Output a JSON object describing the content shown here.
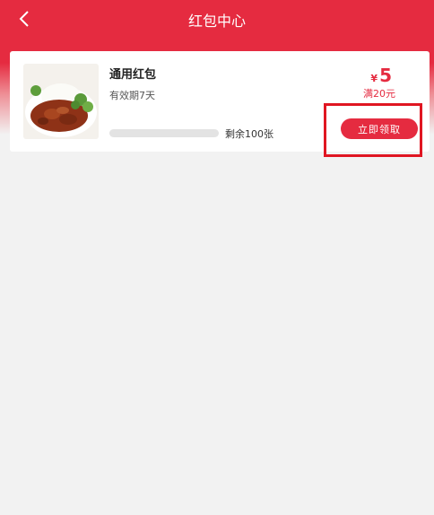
{
  "header": {
    "title": "红包中心",
    "back_icon": "chevron-left-icon"
  },
  "coupon": {
    "name": "通用红包",
    "validity": "有效期7天",
    "currency": "¥",
    "amount": "5",
    "condition": "满20元",
    "remaining": "剩余100张",
    "claim_label": "立即领取",
    "progress_claimed_fraction": 0.0
  },
  "colors": {
    "brand": "#e52b40",
    "background": "#f2f2f2",
    "highlight": "#e01622"
  }
}
